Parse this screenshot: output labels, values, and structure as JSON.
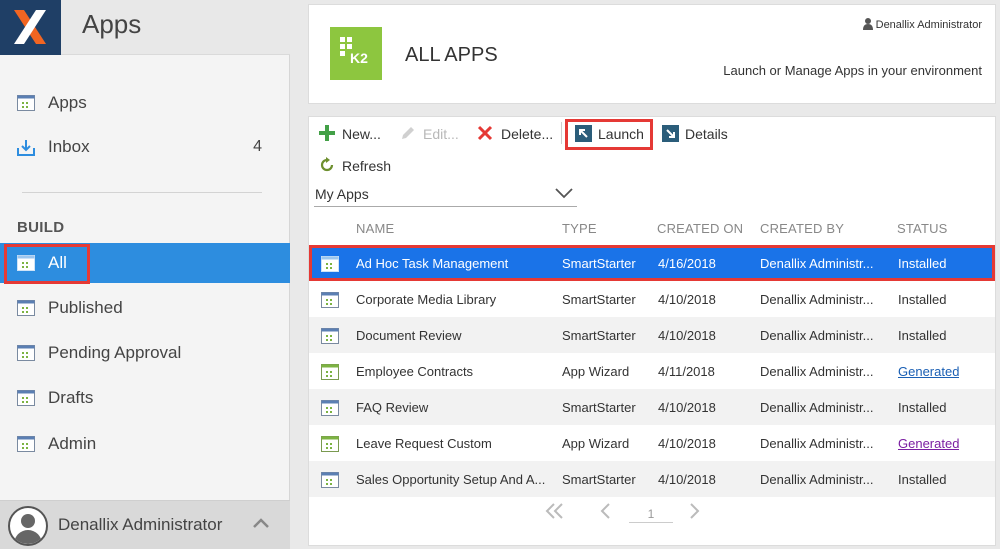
{
  "sidebar": {
    "title": "Apps",
    "items_top": [
      {
        "label": "Apps",
        "icon": "app-icon"
      },
      {
        "label": "Inbox",
        "count": "4",
        "icon": "inbox-icon"
      }
    ],
    "section_label": "BUILD",
    "items_build": [
      {
        "label": "All",
        "active": true,
        "icon": "app-icon"
      },
      {
        "label": "Published",
        "icon": "app-icon"
      },
      {
        "label": "Pending Approval",
        "icon": "app-icon"
      },
      {
        "label": "Drafts",
        "icon": "app-icon"
      },
      {
        "label": "Admin",
        "icon": "app-icon"
      }
    ],
    "user": "Denallix Administrator"
  },
  "header": {
    "title": "ALL APPS",
    "logo_text": "K2",
    "user": "Denallix Administrator",
    "subtitle": "Launch or Manage Apps in your environment"
  },
  "toolbar": {
    "new": "New...",
    "edit": "Edit...",
    "delete": "Delete...",
    "launch": "Launch",
    "details": "Details",
    "refresh": "Refresh"
  },
  "filter": {
    "selected": "My Apps"
  },
  "table": {
    "columns": [
      "NAME",
      "TYPE",
      "CREATED ON",
      "CREATED BY",
      "STATUS"
    ],
    "rows": [
      {
        "name": "Ad Hoc Task Management",
        "type": "SmartStarter",
        "created_on": "4/16/2018",
        "created_by": "Denallix Administr...",
        "status": "Installed"
      },
      {
        "name": "Corporate Media Library",
        "type": "SmartStarter",
        "created_on": "4/10/2018",
        "created_by": "Denallix Administr...",
        "status": "Installed"
      },
      {
        "name": "Document Review",
        "type": "SmartStarter",
        "created_on": "4/10/2018",
        "created_by": "Denallix Administr...",
        "status": "Installed"
      },
      {
        "name": "Employee Contracts",
        "type": "App Wizard",
        "created_on": "4/11/2018",
        "created_by": "Denallix Administr...",
        "status": "Generated"
      },
      {
        "name": "FAQ Review",
        "type": "SmartStarter",
        "created_on": "4/10/2018",
        "created_by": "Denallix Administr...",
        "status": "Installed"
      },
      {
        "name": "Leave Request Custom",
        "type": "App Wizard",
        "created_on": "4/10/2018",
        "created_by": "Denallix Administr...",
        "status": "Generated"
      },
      {
        "name": "Sales Opportunity Setup And A...",
        "type": "SmartStarter",
        "created_on": "4/10/2018",
        "created_by": "Denallix Administr...",
        "status": "Installed"
      }
    ]
  },
  "pager": {
    "page": "1"
  },
  "colors": {
    "accent": "#2d8ddf",
    "selection": "#1a73e8",
    "highlight": "#e53935",
    "brand_green": "#8dc63f",
    "logo_bg": "#1f3f66",
    "logo_x": "#f26522"
  }
}
